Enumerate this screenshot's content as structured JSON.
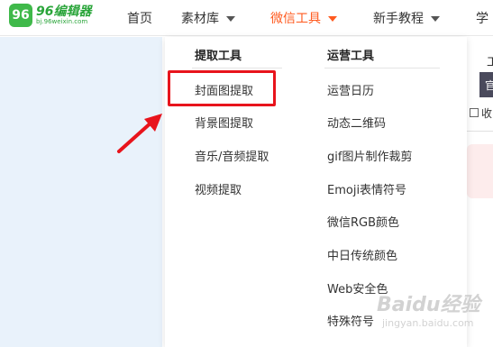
{
  "logo": {
    "mark": "96",
    "name": "96编辑器",
    "url": "bj.96weixin.com"
  },
  "nav": {
    "items": [
      {
        "label": "首页"
      },
      {
        "label": "素材库"
      },
      {
        "label": "微信工具"
      },
      {
        "label": "新手教程"
      },
      {
        "label": "学"
      }
    ]
  },
  "dropdown": {
    "col1": {
      "title": "提取工具",
      "links": [
        "封面图提取",
        "背景图提取",
        "音乐/音频提取",
        "视频提取"
      ]
    },
    "col2": {
      "title": "运营工具",
      "links": [
        "运营日历",
        "动态二维码",
        "gif图片制作裁剪",
        "Emoji表情符号",
        "微信RGB颜色",
        "中日传统颜色",
        "Web安全色",
        "特殊符号"
      ]
    }
  },
  "right_strip": {
    "text": "工",
    "button": "官",
    "checkbox_label": "收"
  },
  "watermark": {
    "main": "Baidu经验",
    "sub": "jingyan.baidu.com"
  },
  "colors": {
    "accent": "#ff5a1f",
    "highlight": "#e8141c",
    "brand": "#3fb94a"
  }
}
